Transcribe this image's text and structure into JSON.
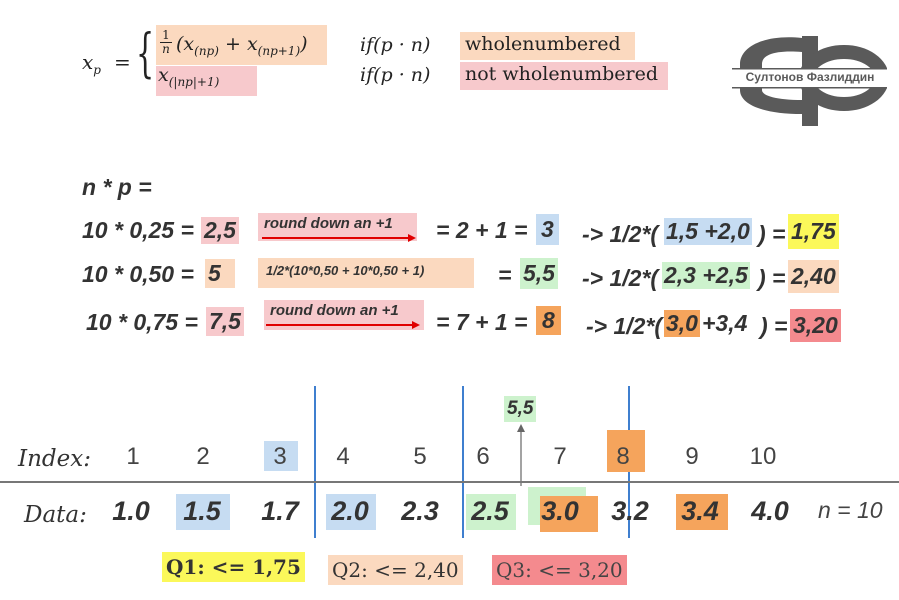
{
  "formula": {
    "lhs": "x",
    "lhs_sub": "p",
    "equals": "=",
    "frac_num": "1",
    "frac_den": "n",
    "case1_term1": "x",
    "case1_term1_sub": "(np)",
    "plus": "+",
    "case1_term2": "x",
    "case1_term2_sub": "(np+1)",
    "paren_open": "(",
    "paren_close": ")",
    "case2_term": "x",
    "case2_sub": "(|np|+1)",
    "condition1": "if(p · n)",
    "condition2": "if(p · n)",
    "label1": "wholenumbered",
    "label2": "not wholenumbered"
  },
  "logo": {
    "text": "Султонов Фазлиддин",
    "color": "#5a5a5a"
  },
  "calc": {
    "header": "n * p =",
    "rows": [
      {
        "expr": "10 * 0,25 =",
        "result": "2,5",
        "note": "round down an +1",
        "eq": "= 2 + 1 =",
        "index": "3",
        "arrow": "-> 1/2*(",
        "pair": "1,5 +2,0",
        "close": ") =",
        "quartile": "1,75"
      },
      {
        "expr": "10 * 0,50 =",
        "result": "5",
        "note": "1/2*(10*0,50 + 10*0,50 + 1)",
        "eq": "=",
        "index": "5,5",
        "arrow": "-> 1/2*(",
        "pair": "2,3 +2,5",
        "close": ") =",
        "quartile": "2,40"
      },
      {
        "expr": "10 * 0,75 =",
        "result": "7,5",
        "note": "round down an +1",
        "eq": "= 7 + 1 =",
        "index": "8",
        "arrow": "-> 1/2*(",
        "pair_a": "3,0",
        "pair_b": " +3,4",
        "close": ") =",
        "quartile": "3,20"
      }
    ]
  },
  "table": {
    "index_label": "Index:",
    "data_label": "Data:",
    "indices": [
      "1",
      "2",
      "3",
      "4",
      "5",
      "6",
      "7",
      "8",
      "9",
      "10"
    ],
    "data": [
      "1.0",
      "1.5",
      "1.7",
      "2.0",
      "2.3",
      "2.5",
      "3.0",
      "3.2",
      "3.4",
      "4.0"
    ],
    "n_label": "n = 10",
    "median_marker": "5,5"
  },
  "quartiles": {
    "q1": "Q1: <= 1,75",
    "q2": "Q2: <= 2,40",
    "q3": "Q3: <= 3,20"
  },
  "colors": {
    "pink": "#f7c9cc",
    "peach": "#fbd9bf",
    "blue": "#c6dcf2",
    "green": "#cdf2cd",
    "orange": "#f5a45c",
    "yellow": "#fbf85a",
    "red": "#f48a8e",
    "line_blue": "#3f7fcf",
    "arrow_red": "#e00000"
  }
}
